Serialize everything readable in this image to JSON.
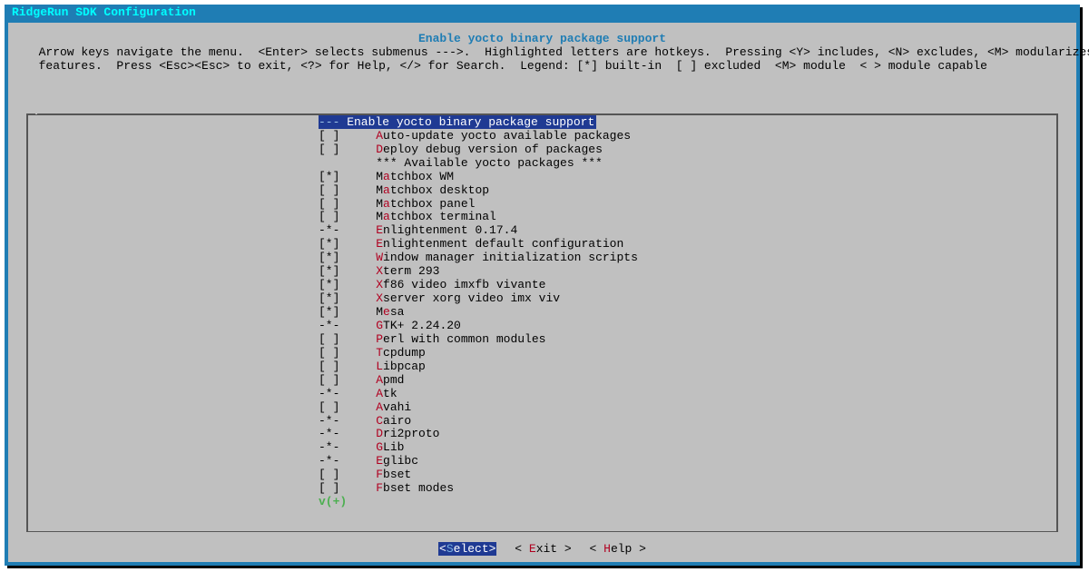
{
  "window": {
    "title": "RidgeRun SDK Configuration"
  },
  "dialog": {
    "title": "Enable yocto binary package support",
    "instructions": "  Arrow keys navigate the menu.  <Enter> selects submenus --->.  Highlighted letters are hotkeys.  Pressing <Y> includes, <N> excludes, <M> modularizes\n  features.  Press <Esc><Esc> to exit, <?> for Help, </> for Search.  Legend: [*] built-in  [ ] excluded  <M> module  < > module capable"
  },
  "menu": {
    "items": [
      {
        "bracket": "---",
        "hotkey": "",
        "label": " Enable yocto binary package support",
        "selected": true
      },
      {
        "bracket": "[ ]",
        "hotkey": "A",
        "label": "uto-update yocto available packages"
      },
      {
        "bracket": "[ ]",
        "hotkey": "D",
        "label": "eploy debug version of packages"
      },
      {
        "bracket": "   ",
        "hotkey": "",
        "label": "*** Available yocto packages ***",
        "section": true
      },
      {
        "bracket": "[*]",
        "hotkey": "a",
        "label": "tchbox WM",
        "prefix": "M"
      },
      {
        "bracket": "[ ]",
        "hotkey": "a",
        "label": "tchbox desktop",
        "prefix": "M"
      },
      {
        "bracket": "[ ]",
        "hotkey": "a",
        "label": "tchbox panel",
        "prefix": "M"
      },
      {
        "bracket": "[ ]",
        "hotkey": "a",
        "label": "tchbox terminal",
        "prefix": "M"
      },
      {
        "bracket": "-*-",
        "hotkey": "E",
        "label": "nlightenment 0.17.4"
      },
      {
        "bracket": "[*]",
        "hotkey": "E",
        "label": "nlightenment default configuration"
      },
      {
        "bracket": "[*]",
        "hotkey": "W",
        "label": "indow manager initialization scripts"
      },
      {
        "bracket": "[*]",
        "hotkey": "X",
        "label": "term 293"
      },
      {
        "bracket": "[*]",
        "hotkey": "X",
        "label": "f86 video imxfb vivante"
      },
      {
        "bracket": "[*]",
        "hotkey": "X",
        "label": "server xorg video imx viv"
      },
      {
        "bracket": "[*]",
        "hotkey": "e",
        "label": "sa",
        "prefix": "M"
      },
      {
        "bracket": "-*-",
        "hotkey": "G",
        "label": "TK+ 2.24.20"
      },
      {
        "bracket": "[ ]",
        "hotkey": "P",
        "label": "erl with common modules"
      },
      {
        "bracket": "[ ]",
        "hotkey": "T",
        "label": "cpdump"
      },
      {
        "bracket": "[ ]",
        "hotkey": "L",
        "label": "ibpcap"
      },
      {
        "bracket": "[ ]",
        "hotkey": "A",
        "label": "pmd"
      },
      {
        "bracket": "-*-",
        "hotkey": "A",
        "label": "tk"
      },
      {
        "bracket": "[ ]",
        "hotkey": "A",
        "label": "vahi"
      },
      {
        "bracket": "-*-",
        "hotkey": "C",
        "label": "airo"
      },
      {
        "bracket": "-*-",
        "hotkey": "D",
        "label": "ri2proto"
      },
      {
        "bracket": "-*-",
        "hotkey": "G",
        "label": "Lib"
      },
      {
        "bracket": "-*-",
        "hotkey": "E",
        "label": "glibc"
      },
      {
        "bracket": "[ ]",
        "hotkey": "F",
        "label": "bset"
      },
      {
        "bracket": "[ ]",
        "hotkey": "F",
        "label": "bset modes"
      }
    ],
    "scroll_indicator": "v(+)"
  },
  "buttons": {
    "select": "Select",
    "exit_pre": "< ",
    "exit_hot": "E",
    "exit_post": "xit >",
    "help_pre": "< ",
    "help_hot": "H",
    "help_post": "elp >"
  }
}
